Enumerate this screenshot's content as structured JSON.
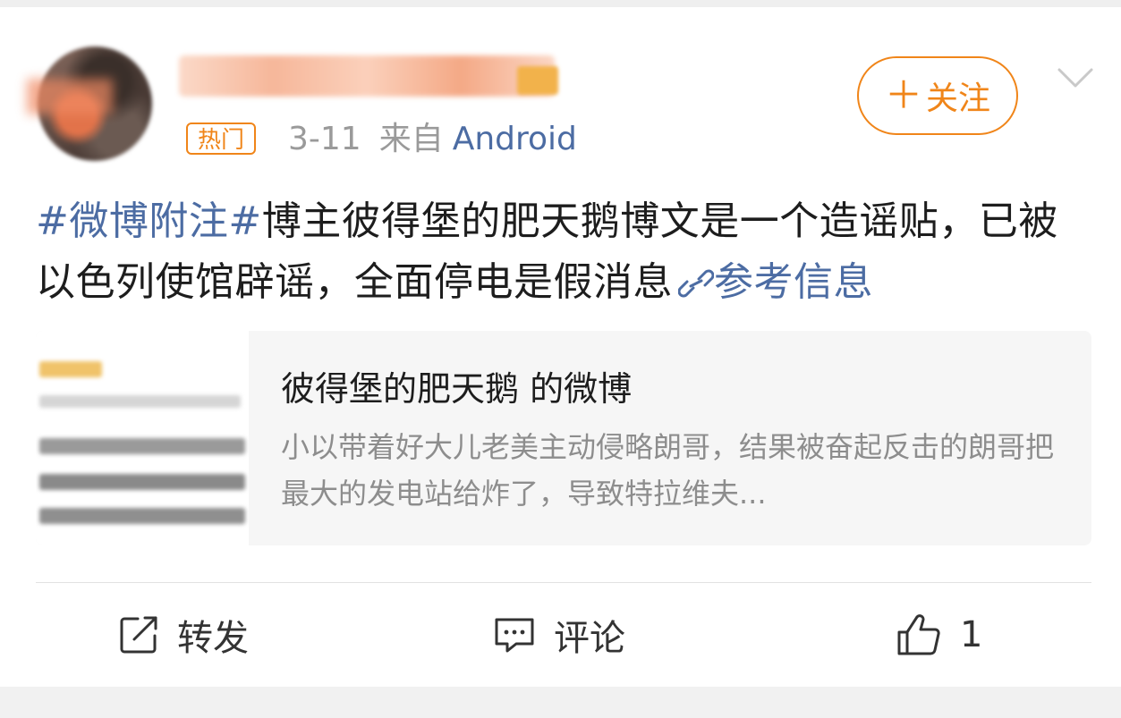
{
  "post": {
    "hot_tag": "热门",
    "date": "3-11",
    "source_prefix": "来自",
    "source_device": "Android",
    "follow_label": "关注",
    "topic": "#微博附注#",
    "text": "博主彼得堡的肥天鹅博文是一个造谣贴，已被以色列使馆辟谣，全面停电是假消息",
    "reference_link": "参考信息"
  },
  "quote": {
    "title": "彼得堡的肥天鹅 的微博",
    "body": "小以带着好大儿老美主动侵略朗哥，结果被奋起反击的朗哥把最大的发电站给炸了，导致特拉维夫..."
  },
  "actions": {
    "repost_label": "转发",
    "comment_label": "评论",
    "like_count": "1"
  },
  "colors": {
    "accent_orange": "#f08519",
    "link_blue": "#4c6ca3",
    "text_dark": "#1d1d1d",
    "text_gray": "#9a9a9a"
  },
  "icons": {
    "follow": "plus-icon",
    "menu": "chevron-down-icon",
    "link": "link-icon",
    "repost": "share-icon",
    "comment": "comment-icon",
    "like": "thumbs-up-icon"
  }
}
